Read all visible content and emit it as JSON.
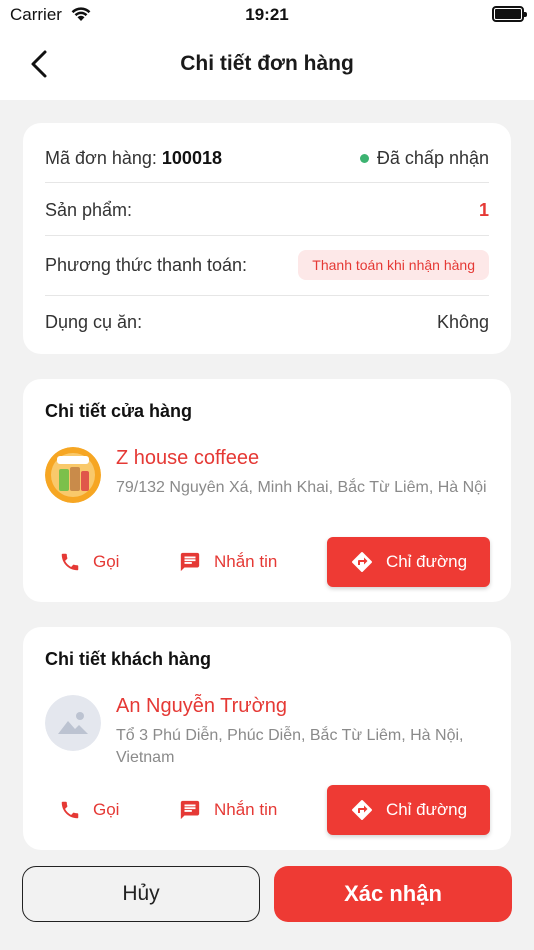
{
  "status_bar": {
    "carrier": "Carrier",
    "time": "19:21"
  },
  "header": {
    "title": "Chi tiết đơn hàng"
  },
  "order": {
    "code_label": "Mã đơn hàng:",
    "code_value": "100018",
    "status": "Đã chấp nhận",
    "products_label": "Sản phẩm:",
    "products_count": "1",
    "payment_label": "Phương thức thanh toán:",
    "payment_method": "Thanh toán khi nhận hàng",
    "cutlery_label": "Dụng cụ ăn:",
    "cutlery_value": "Không"
  },
  "store": {
    "heading": "Chi tiết cửa hàng",
    "name": "Z house coffeee",
    "address": "79/132 Nguyên Xá, Minh Khai, Bắc Từ Liêm, Hà Nội",
    "call_label": "Gọi",
    "message_label": "Nhắn tin",
    "directions_label": "Chỉ đường"
  },
  "customer": {
    "heading": "Chi tiết khách hàng",
    "name": "An Nguyễn Trường",
    "address": "Tổ 3 Phú Diễn, Phúc Diễn, Bắc Từ Liêm, Hà Nội, Vietnam",
    "call_label": "Gọi",
    "message_label": "Nhắn tin",
    "directions_label": "Chỉ đường"
  },
  "footer": {
    "cancel_label": "Hủy",
    "confirm_label": "Xác nhận"
  },
  "colors": {
    "accent": "#ee3a34",
    "status_green": "#3cb371",
    "badge_bg": "#fde8e8"
  },
  "icons": [
    "back-icon",
    "phone-icon",
    "message-icon",
    "directions-icon",
    "wifi-icon",
    "battery-icon",
    "store-logo",
    "avatar-placeholder-icon"
  ]
}
